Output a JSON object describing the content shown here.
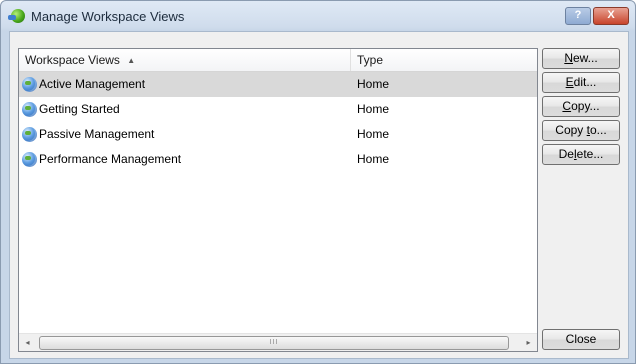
{
  "window": {
    "title": "Manage Workspace Views",
    "help_label": "?",
    "close_label": "X"
  },
  "list": {
    "columns": {
      "name": "Workspace Views",
      "type": "Type"
    },
    "sort_indicator": "▲",
    "rows": [
      {
        "name": "Active Management",
        "type": "Home",
        "selected": true
      },
      {
        "name": "Getting Started",
        "type": "Home",
        "selected": false
      },
      {
        "name": "Passive Management",
        "type": "Home",
        "selected": false
      },
      {
        "name": "Performance Management",
        "type": "Home",
        "selected": false
      }
    ],
    "scroll_grip": "III",
    "scroll_left": "◂",
    "scroll_right": "▸"
  },
  "buttons": {
    "new": {
      "mnemonic": "N",
      "rest": "ew..."
    },
    "edit": {
      "mnemonic": "E",
      "rest": "dit..."
    },
    "copy": {
      "mnemonic": "C",
      "rest": "opy..."
    },
    "copy_to_before": "Copy ",
    "copy_to_mnemonic": "t",
    "copy_to_after": "o...",
    "delete_before": "De",
    "delete_mnemonic": "l",
    "delete_after": "ete...",
    "close": "Close"
  }
}
